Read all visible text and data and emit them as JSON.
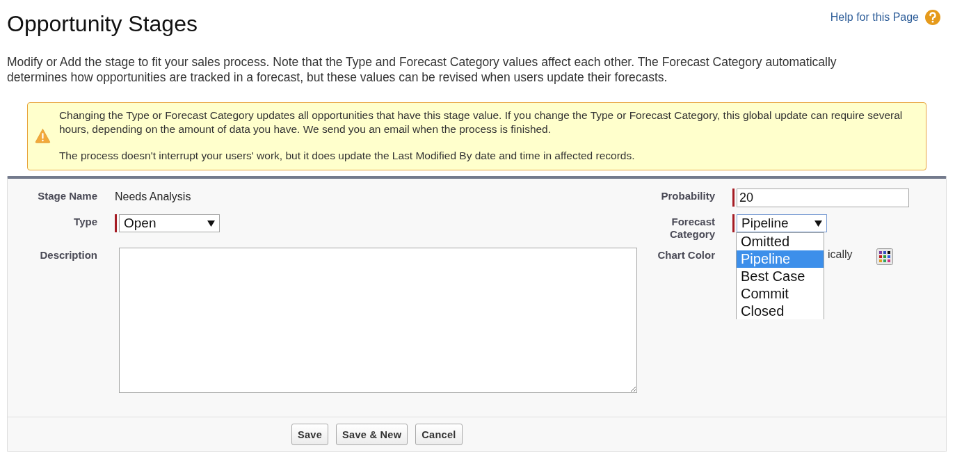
{
  "page": {
    "title": "Opportunity Stages",
    "help_link": "Help for this Page",
    "intro": "Modify or Add the stage to fit your sales process. Note that the Type and Forecast Category values affect each other. The Forecast Category automatically determines how opportunities are tracked in a forecast, but these values can be revised when users update their forecasts."
  },
  "alert": {
    "paragraphs": [
      "Changing the Type or Forecast Category updates all opportunities that have this stage value. If you change the Type or Forecast Category, this global update can require several hours, depending on the amount of data you have. We send you an email when the process is finished.",
      "The process doesn't interrupt your users' work, but it does update the Last Modified By date and time in affected records."
    ]
  },
  "form": {
    "fields": [
      {
        "kind": "text",
        "label": "Stage Name",
        "value": "Needs Analysis",
        "required": false
      },
      {
        "kind": "input",
        "label": "Probability",
        "value": "20",
        "required": true
      },
      {
        "kind": "select",
        "label": "Type",
        "value": "Open",
        "required": true
      },
      {
        "kind": "dropdown",
        "label": "Forecast Category",
        "value": "Pipeline",
        "required": true,
        "options": [
          {
            "label": "Omitted",
            "selected": false
          },
          {
            "label": "Pipeline",
            "selected": true
          },
          {
            "label": "Best Case",
            "selected": false
          },
          {
            "label": "Commit",
            "selected": false
          },
          {
            "label": "Closed",
            "selected": false
          }
        ]
      },
      {
        "kind": "textarea",
        "label": "Description",
        "required": false
      },
      {
        "kind": "color",
        "label": "Chart Color",
        "value": "ically",
        "required": false
      }
    ],
    "buttons": [
      "Save",
      "Save & New",
      "Cancel"
    ]
  }
}
